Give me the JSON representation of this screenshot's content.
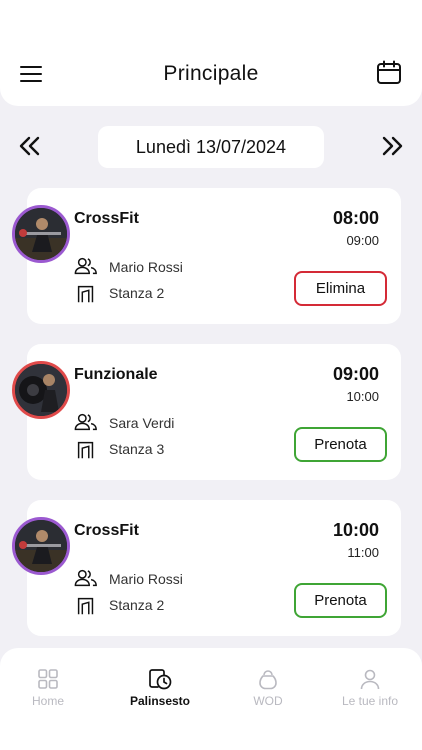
{
  "header": {
    "title": "Principale",
    "menu_icon": "hamburger-menu-icon",
    "calendar_icon": "calendar-icon"
  },
  "date_nav": {
    "prev_icon": "double-chevron-left-icon",
    "next_icon": "double-chevron-right-icon",
    "date_label": "Lunedì 13/07/2024"
  },
  "classes": [
    {
      "name": "CrossFit",
      "start": "08:00",
      "end": "09:00",
      "trainer": "Mario Rossi",
      "room": "Stanza 2",
      "action_label": "Elimina",
      "action_color": "#d42a36",
      "avatar_border": "#9b59d0"
    },
    {
      "name": "Funzionale",
      "start": "09:00",
      "end": "10:00",
      "trainer": "Sara Verdi",
      "room": "Stanza 3",
      "action_label": "Prenota",
      "action_color": "#3fa535",
      "avatar_border": "#e04a4a"
    },
    {
      "name": "CrossFit",
      "start": "10:00",
      "end": "11:00",
      "trainer": "Mario Rossi",
      "room": "Stanza 2",
      "action_label": "Prenota",
      "action_color": "#3fa535",
      "avatar_border": "#9b59d0"
    }
  ],
  "bottom_nav": {
    "items": [
      {
        "label": "Home",
        "icon": "grid-icon",
        "active": false
      },
      {
        "label": "Palinsesto",
        "icon": "schedule-icon",
        "active": true
      },
      {
        "label": "WOD",
        "icon": "kettlebell-icon",
        "active": false
      },
      {
        "label": "Le tue info",
        "icon": "user-icon",
        "active": false
      }
    ]
  }
}
